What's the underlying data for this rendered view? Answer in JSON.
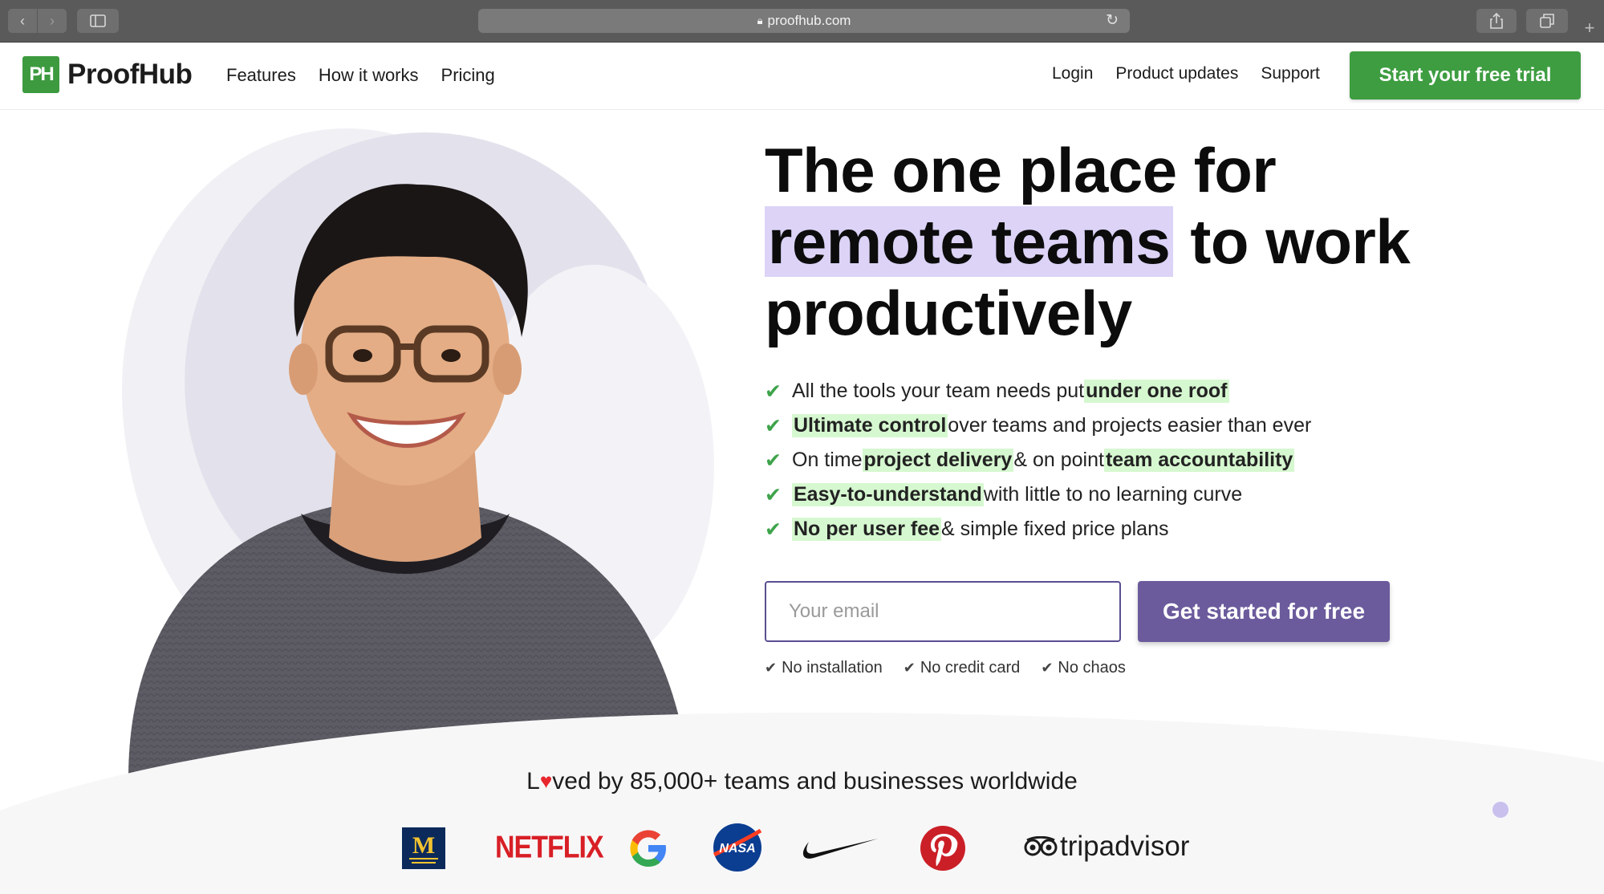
{
  "browser": {
    "url": "proofhub.com",
    "back_icon": "chevron-left-icon",
    "forward_icon": "chevron-right-icon",
    "sidebar_icon": "sidebar-icon",
    "share_icon": "share-icon",
    "tabs_icon": "tabs-icon",
    "new_tab_icon": "plus-icon",
    "reload_icon": "reload-icon",
    "lock_icon": "lock-icon"
  },
  "header": {
    "logo_mark": "PH",
    "logo_text": "ProofHub",
    "nav": [
      "Features",
      "How it works",
      "Pricing"
    ],
    "right_nav": [
      "Login",
      "Product updates",
      "Support"
    ],
    "trial_button": "Start your free trial"
  },
  "hero": {
    "headline_line1": "The one place for",
    "headline_highlight": "remote teams",
    "headline_line2_rest": " to work",
    "headline_line3": "productively",
    "features": [
      {
        "pre": "All the tools your team needs put ",
        "hl": "under one roof",
        "mid": "",
        "hl2": "",
        "post": ""
      },
      {
        "pre": "",
        "hl": "Ultimate control",
        "mid": "",
        "hl2": "",
        "post": " over teams and projects easier than ever"
      },
      {
        "pre": "On time ",
        "hl": "project delivery",
        "mid": " & on point ",
        "hl2": "team accountability",
        "post": ""
      },
      {
        "pre": "",
        "hl": "Easy-to-understand",
        "mid": "",
        "hl2": "",
        "post": " with little to no learning curve"
      },
      {
        "pre": "",
        "hl": "No per user fee",
        "mid": "",
        "hl2": "",
        "post": " & simple fixed price plans"
      }
    ],
    "email_placeholder": "Your email",
    "cta_button": "Get started for free",
    "perks": [
      "No installation",
      "No credit card",
      "No chaos"
    ]
  },
  "social_proof": {
    "loved_prefix": "L",
    "loved_suffix": "ved by 85,000+ teams and businesses worldwide",
    "brands": {
      "michigan": "M",
      "netflix": "NETFLIX",
      "nasa": "NASA",
      "tripadvisor": "tripadvisor"
    }
  },
  "colors": {
    "brand_green": "#3e9d41",
    "cta_purple": "#6b5b9c",
    "highlight_purple": "#dcd3f7",
    "highlight_green": "#d6f8d0",
    "heart_red": "#e8262e"
  }
}
